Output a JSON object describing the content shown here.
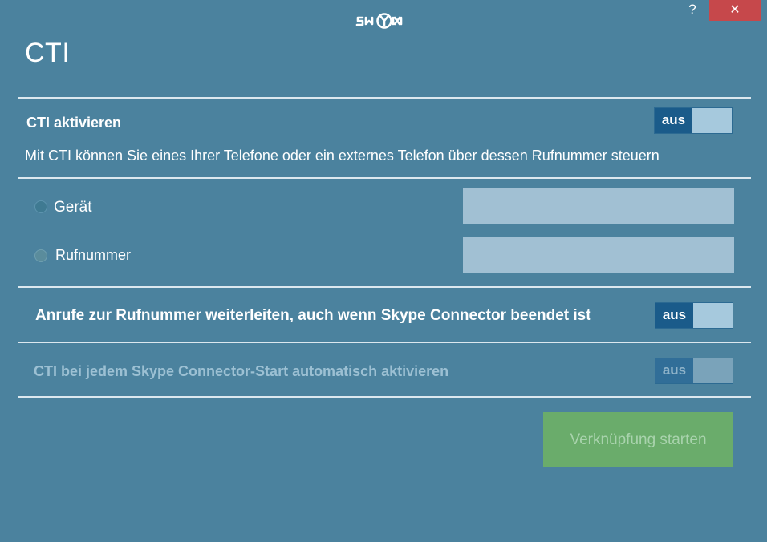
{
  "app": {
    "logo_icon": "swyx-logo-icon",
    "help_label": "?",
    "close_label": "✕"
  },
  "page": {
    "title": "CTI"
  },
  "cti": {
    "enable_label": "CTI aktivieren",
    "enable_toggle": "aus",
    "description": "Mit CTI können Sie eines Ihrer Telefone oder ein externes Telefon über dessen Rufnummer steuern"
  },
  "target": {
    "device_label": "Gerät",
    "device_value": "",
    "number_label": "Rufnummer",
    "number_value": ""
  },
  "forward": {
    "label": "Anrufe zur Rufnummer weiterleiten, auch wenn Skype Connector beendet ist",
    "toggle": "aus"
  },
  "autostart": {
    "label": "CTI bei jedem Skype Connector-Start automatisch aktivieren",
    "toggle": "aus"
  },
  "actions": {
    "start_label": "Verknüpfung starten"
  },
  "colors": {
    "background": "#4b829e",
    "close_button": "#c6484b",
    "toggle_off": "#1a5b8a",
    "start_button": "#6aac6b"
  }
}
